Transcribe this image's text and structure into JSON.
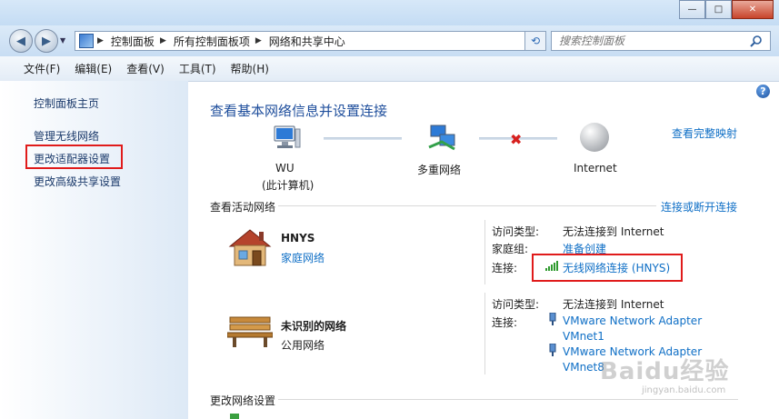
{
  "window": {
    "minimize_glyph": "—",
    "maximize_glyph": "□",
    "close_glyph": "✕"
  },
  "nav": {
    "back_icon": "arrow-left-icon",
    "forward_icon": "arrow-right-icon",
    "breadcrumbs": [
      "控制面板",
      "所有控制面板项",
      "网络和共享中心"
    ],
    "search_placeholder": "搜索控制面板"
  },
  "menu": [
    "文件(F)",
    "编辑(E)",
    "查看(V)",
    "工具(T)",
    "帮助(H)"
  ],
  "sidebar": {
    "items": [
      "控制面板主页",
      "管理无线网络",
      "更改适配器设置",
      "更改高级共享设置"
    ]
  },
  "main": {
    "title": "查看基本网络信息并设置连接",
    "full_map_link": "查看完整映射",
    "map": {
      "computer_name": "WU",
      "computer_sub": "(此计算机)",
      "middle": "多重网络",
      "internet": "Internet"
    },
    "active_networks_heading": "查看活动网络",
    "connect_disconnect_link": "连接或断开连接",
    "networks": [
      {
        "name": "HNYS",
        "type": "家庭网络",
        "access_type_label": "访问类型:",
        "access_type": "无法连接到 Internet",
        "homegroup_label": "家庭组:",
        "homegroup": "准备创建",
        "connection_label": "连接:",
        "connection": "无线网络连接 (HNYS)"
      },
      {
        "name": "未识别的网络",
        "type": "公用网络",
        "access_type_label": "访问类型:",
        "access_type": "无法连接到 Internet",
        "connection_label": "连接:",
        "connection_1a": "VMware Network Adapter",
        "connection_1b": "VMnet1",
        "connection_2a": "VMware Network Adapter",
        "connection_2b": "VMnet8"
      }
    ],
    "change_settings_heading": "更改网络设置"
  },
  "watermark": {
    "text": "Baidu经验",
    "sub": "jingyan.baidu.com"
  },
  "colors": {
    "link": "#0f6fc6",
    "heading": "#1e4e9c",
    "highlight": "#e01b1b",
    "sidebar_gradient_end": "#dde9f6"
  }
}
